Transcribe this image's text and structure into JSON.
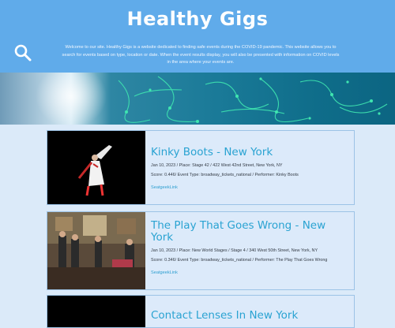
{
  "header": {
    "title": "Healthy Gigs",
    "intro": "Welcome to our site. Healthy Gigs is a website dedicated to finding safe events during the COVID-19 pandemic. This website allows you to search for events based on type, location or date. When the event results display, you will also be presented with information on COVID levels in the area where your events are."
  },
  "icons": {
    "search": "search-icon"
  },
  "colors": {
    "header_bg": "#60abea",
    "page_bg": "#dbeaf9",
    "title_link": "#2aa3d2"
  },
  "events": [
    {
      "title": "Kinky Boots - New York",
      "details": "Jan 10, 2023 / Place: Stage 42 / 422 West 42nd Street, New York, NY",
      "score_line": "Score: 0.446/ Event Type: broadway_tickets_national / Performer: Kinky Boots",
      "link": "SeatgeekLink"
    },
    {
      "title": "The Play That Goes Wrong - New York",
      "details": "Jan 10, 2023 / Place: New World Stages / Stage 4 / 340 West 50th Street, New York, NY",
      "score_line": "Score: 0.346/ Event Type: broadway_tickets_national / Performer: The Play That Goes Wrong",
      "link": "SeatgeekLink"
    },
    {
      "title": "Contact Lenses In New York"
    }
  ]
}
